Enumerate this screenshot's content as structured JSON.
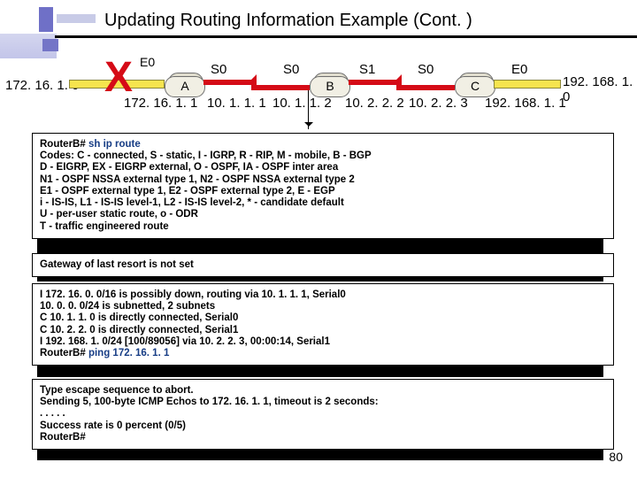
{
  "title": "Updating Routing Information Example (Cont. )",
  "diagram": {
    "labels": {
      "e0_left": "E0",
      "s0_1": "S0",
      "s0_2": "S0",
      "s1": "S1",
      "s0_3": "S0",
      "e0_right": "E0"
    },
    "routers": {
      "a": "A",
      "b": "B",
      "c": "C"
    },
    "x_mark": "X",
    "networks": {
      "left": "172. 16. 1. 0",
      "right": "192. 168. 1. 0"
    },
    "addresses": {
      "a_e0": "172. 16. 1. 1",
      "a_s0": "10. 1. 1. 1",
      "b_s0": "10. 1. 1. 2",
      "b_s1": "10. 2. 2. 2",
      "c_s0": "10. 2. 2. 3",
      "c_e0": "192. 168. 1. 1"
    }
  },
  "cli": {
    "prompt1": "RouterB#",
    "cmd1": " sh ip route",
    "codes": [
      "Codes: C - connected, S - static, I - IGRP, R - RIP, M - mobile, B - BGP",
      "       D - EIGRP, EX - EIGRP external, O - OSPF, IA - OSPF inter area",
      "       N1 - OSPF NSSA external type 1, N2 - OSPF NSSA external type 2",
      "       E1 - OSPF external type 1, E2 - OSPF external type 2, E - EGP",
      "       i - IS-IS, L1 - IS-IS level-1, L2 - IS-IS level-2, * - candidate default",
      "       U - per-user static route, o - ODR",
      "       T - traffic engineered route"
    ],
    "gw": "Gateway of last resort is not set",
    "routes": [
      "I    172. 16. 0. 0/16 is possibly down, routing via 10. 1. 1. 1, Serial0",
      "     10. 0. 0. 0/24 is subnetted, 2 subnets",
      "C       10. 1. 1. 0 is directly connected, Serial0",
      "C       10. 2. 2. 0 is directly connected, Serial1",
      "I    192. 168. 1. 0/24 [100/89056] via 10. 2. 2. 3, 00:00:14, Serial1"
    ],
    "prompt2": "RouterB#",
    "cmd2": " ping 172. 16. 1. 1",
    "ping": [
      "Type escape sequence to abort.",
      "Sending 5, 100-byte ICMP Echos to 172. 16. 1. 1, timeout is 2 seconds:",
      ". . . . .",
      "Success rate is 0 percent (0/5)"
    ],
    "prompt3": "RouterB#"
  },
  "page_number": "80"
}
